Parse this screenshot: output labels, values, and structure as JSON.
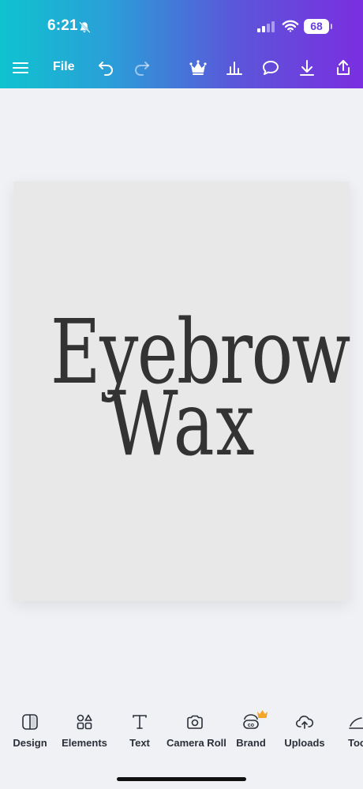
{
  "status": {
    "time": "6:21",
    "battery": "68"
  },
  "toolbar": {
    "file_label": "File"
  },
  "canvas": {
    "line1": "Eyebrow",
    "line2": "Wax"
  },
  "bottom_tools": [
    {
      "label": "Design",
      "icon": "layout-icon"
    },
    {
      "label": "Elements",
      "icon": "shapes-icon"
    },
    {
      "label": "Text",
      "icon": "text-icon"
    },
    {
      "label": "Camera Roll",
      "icon": "camera-icon"
    },
    {
      "label": "Brand",
      "icon": "brand-icon"
    },
    {
      "label": "Uploads",
      "icon": "upload-cloud-icon"
    },
    {
      "label": "Too",
      "icon": "tools-icon"
    }
  ],
  "colors": {
    "header_gradient_start": "#0fc3cf",
    "header_gradient_end": "#7b2ee0",
    "canvas_bg": "#e8e8e9",
    "text_dark": "#333333",
    "premium_crown": "#f4a62a"
  }
}
